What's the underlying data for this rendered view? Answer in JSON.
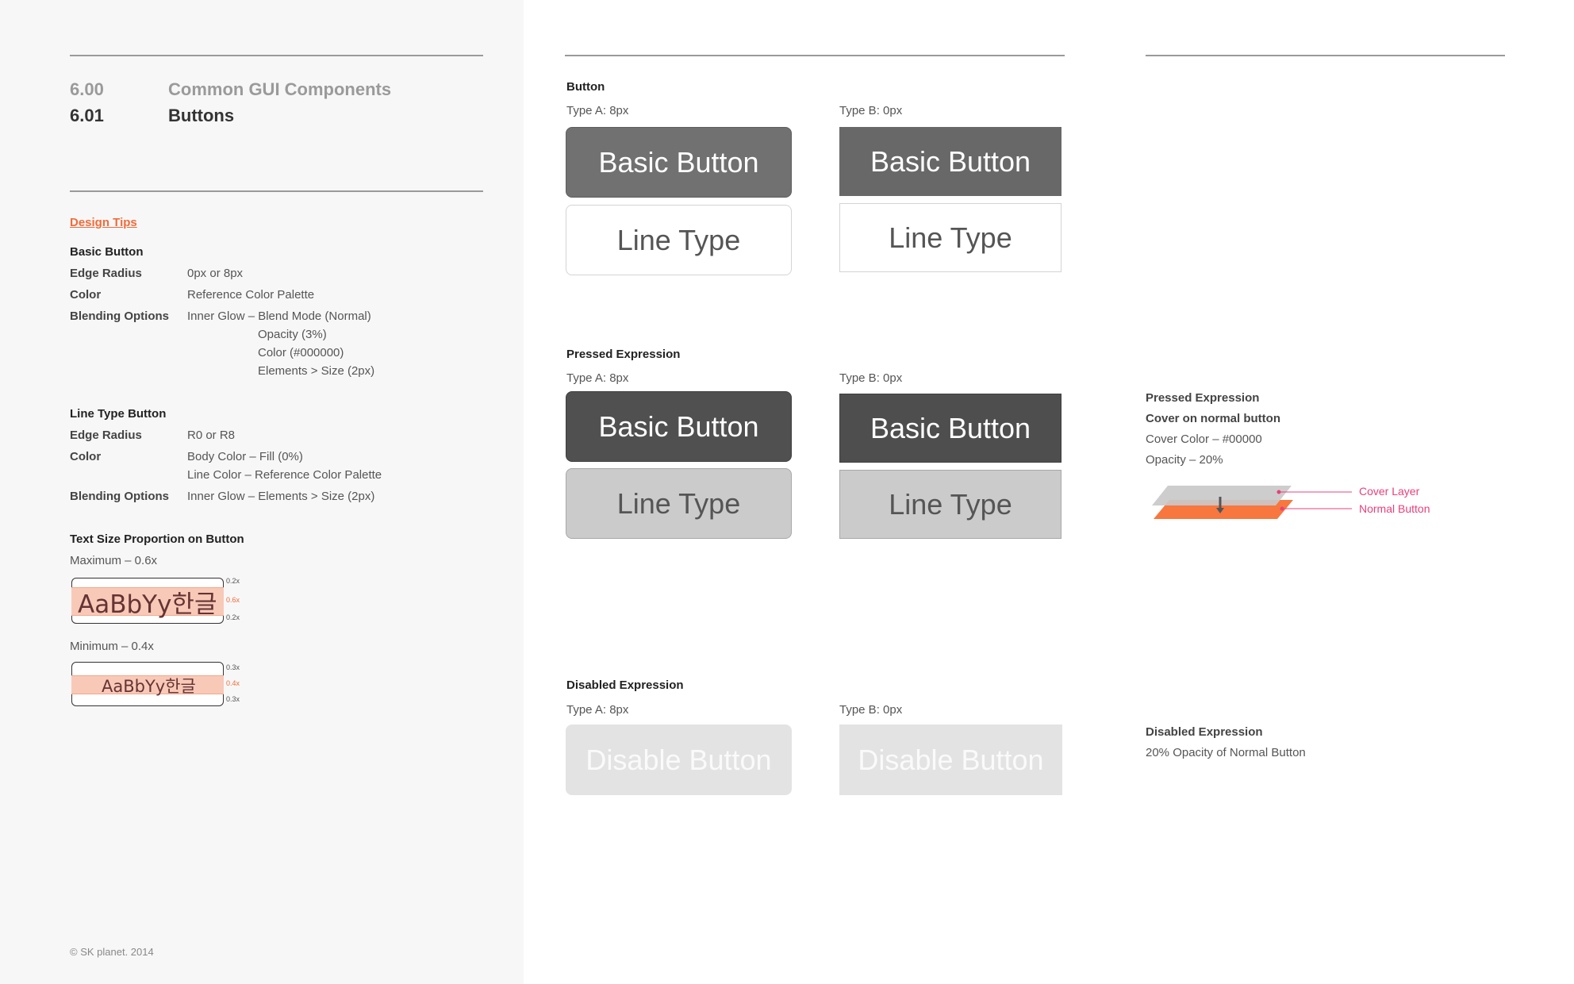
{
  "header": {
    "section_number": "6.00",
    "section_title": "Common GUI Components",
    "subsection_number": "6.01",
    "subsection_title": "Buttons"
  },
  "design_tips": {
    "title": "Design Tips",
    "basic_button": {
      "heading": "Basic Button",
      "edge_radius_label": "Edge Radius",
      "edge_radius_value": "0px or 8px",
      "color_label": "Color",
      "color_value": "Reference Color Palette",
      "blending_label": "Blending Options",
      "blending_lines": [
        "Inner Glow – Blend Mode (Normal)",
        "Opacity (3%)",
        "Color (#000000)",
        "Elements > Size (2px)"
      ]
    },
    "line_type_button": {
      "heading": "Line Type Button",
      "edge_radius_label": "Edge Radius",
      "edge_radius_value": "R0 or R8",
      "color_label": "Color",
      "color_lines": [
        "Body Color – Fill (0%)",
        "Line Color – Reference Color Palette"
      ],
      "blending_label": "Blending Options",
      "blending_value": "Inner Glow – Elements > Size (2px)"
    },
    "text_size": {
      "heading": "Text Size Proportion on Button",
      "max_label": "Maximum – 0.6x",
      "max_sample": "AaBbYy한글",
      "max_ticks": [
        "0.2x",
        "0.6x",
        "0.2x"
      ],
      "min_label": "Minimum – 0.4x",
      "min_sample": "AaBbYy한글",
      "min_ticks": [
        "0.3x",
        "0.4x",
        "0.3x"
      ]
    }
  },
  "footer": "© SK planet. 2014",
  "normal": {
    "title": "Button",
    "type_a": "Type A: 8px",
    "type_b": "Type B: 0px",
    "basic_label": "Basic Button",
    "line_label": "Line Type"
  },
  "pressed": {
    "title": "Pressed Expression",
    "type_a": "Type A: 8px",
    "type_b": "Type B: 0px",
    "basic_label": "Basic Button",
    "line_label": "Line Type"
  },
  "disabled": {
    "title": "Disabled Expression",
    "type_a": "Type A: 8px",
    "type_b": "Type B: 0px",
    "label": "Disable Button"
  },
  "notes": {
    "pressed_title": "Pressed Expression",
    "pressed_sub": "Cover on normal button",
    "cover_color": "Cover Color – #00000",
    "opacity": "Opacity – 20%",
    "cover_layer": "Cover Layer",
    "normal_button": "Normal Button",
    "disabled_title": "Disabled Expression",
    "disabled_desc": "20% Opacity of Normal Button"
  },
  "colors": {
    "accent": "#f26b3a",
    "pink": "#e8407a",
    "button_fill": "#717171",
    "pressed_fill": "#505050"
  }
}
